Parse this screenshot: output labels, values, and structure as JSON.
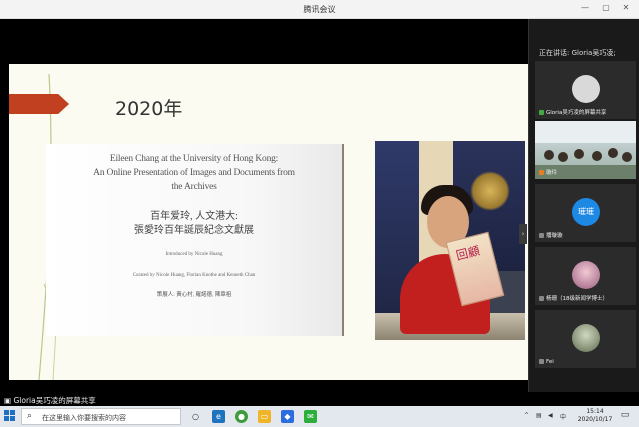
{
  "window": {
    "title": "腾讯会议"
  },
  "slide": {
    "year_title": "2020年",
    "doc_en_line1": "Eileen Chang at the University of Hong Kong:",
    "doc_en_line2": "An Online Presentation of Images and Documents from",
    "doc_en_line3": "the Archives",
    "doc_zh_line1": "百年爱玲, 人文港大:",
    "doc_zh_line2": "張愛玲百年誕辰紀念文獻展",
    "introduced_by": "Introduced by Nicole Huang",
    "curated_by": "Curated by Nicole Huang, Florian Knothe and Kenneth Chan",
    "curators_zh": "策展人: 黃心村, 羅諾德, 陳章祖",
    "book_cover_text": "回顧"
  },
  "sidebar": {
    "speaking_label": "正在讲话: Gloria吴巧凌;",
    "tiles": [
      {
        "name": "Gloria吴巧凌的屏幕共享",
        "avatar_text": ""
      },
      {
        "name": "璇玲",
        "avatar_text": ""
      },
      {
        "name": "播璇璇",
        "avatar_text": "璀璀"
      },
      {
        "name": "杨珊（18级新闻学博士）",
        "avatar_text": ""
      },
      {
        "name": "Fei",
        "avatar_text": ""
      }
    ]
  },
  "share_status": "Gloria吴巧凌的屏幕共享",
  "taskbar": {
    "search_placeholder": "在这里输入你要搜索的内容",
    "time": "15:14",
    "date": "2020/10/17",
    "ime": "中",
    "notif_count": "2"
  },
  "colors": {
    "accent_arrow": "#c1401f",
    "avatar_blue": "#1e88e5"
  }
}
